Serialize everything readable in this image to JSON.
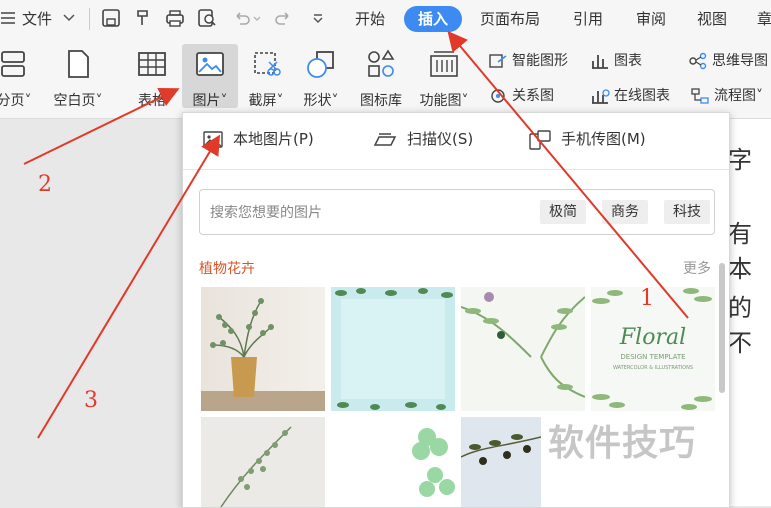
{
  "menubar": {
    "file_label": "文件",
    "tabs": [
      "开始",
      "插入",
      "页面布局",
      "引用",
      "审阅",
      "视图",
      "章"
    ],
    "active_tab": "插入"
  },
  "ribbon": {
    "items": {
      "page_break": "分页",
      "blank_page": "空白页",
      "table": "表格",
      "picture": "图片",
      "screenshot": "截屏",
      "shape": "形状",
      "icon_library": "图标库",
      "function_chart": "功能图"
    },
    "small": {
      "smart_shape": "智能图形",
      "chart": "图表",
      "mind_map": "思维导图",
      "relation_chart": "关系图",
      "online_chart": "在线图表",
      "flowchart": "流程图"
    }
  },
  "document": {
    "text_lines": [
      "主字盖",
      "有本",
      "的不"
    ]
  },
  "dropdown": {
    "local_picture": "本地图片(P)",
    "scanner": "扫描仪(S)",
    "phone_transfer": "手机传图(M)",
    "search_placeholder": "搜索您想要的图片",
    "tags": [
      "极简",
      "商务",
      "科技"
    ],
    "category": "植物花卉",
    "more": "更多",
    "thumbnail_text": [
      "Floral",
      "DESIGN TEMPLATE",
      "WATERCOLOR & ILLUSTRATIONS"
    ]
  },
  "annotations": {
    "arrow_labels": [
      "1",
      "2",
      "3"
    ],
    "arrow_color": "#e03a2a"
  },
  "watermark": "软件技巧",
  "colors": {
    "accent": "#3d8bf2",
    "category_text": "#d6572a"
  }
}
